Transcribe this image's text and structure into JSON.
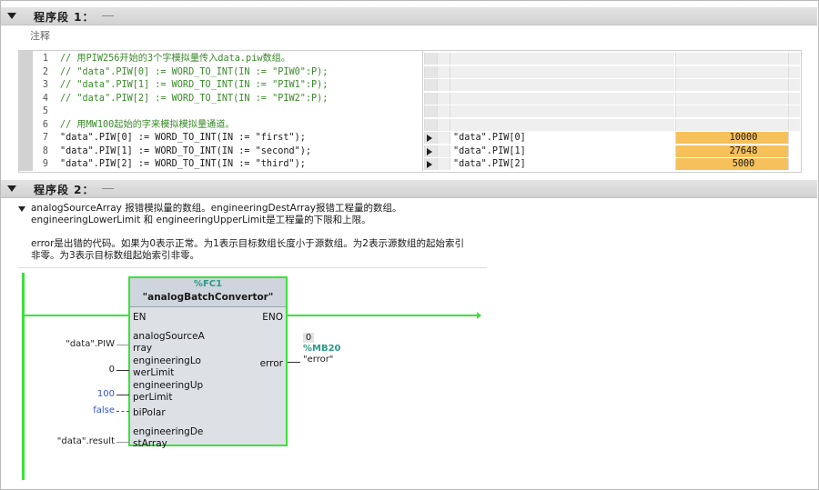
{
  "network1": {
    "title": "程序段 1：",
    "comment": "注释",
    "code": [
      {
        "num": "1",
        "text": "// 用PIW256开始的3个字模拟量传入data.piw数组。",
        "comment": true
      },
      {
        "num": "2",
        "text": "// \"data\".PIW[0] := WORD_TO_INT(IN := \"PIW0\":P);",
        "comment": true
      },
      {
        "num": "3",
        "text": "// \"data\".PIW[1] := WORD_TO_INT(IN := \"PIW1\":P);",
        "comment": true
      },
      {
        "num": "4",
        "text": "// \"data\".PIW[2] := WORD_TO_INT(IN := \"PIW2\":P);",
        "comment": true
      },
      {
        "num": "5",
        "text": "",
        "comment": false
      },
      {
        "num": "6",
        "text": "// 用MW100起始的字来模拟模拟量通道。",
        "comment": true
      },
      {
        "num": "7",
        "text": "\"data\".PIW[0] := WORD_TO_INT(IN := \"first\");",
        "comment": false
      },
      {
        "num": "8",
        "text": "\"data\".PIW[1] := WORD_TO_INT(IN := \"second\");",
        "comment": false
      },
      {
        "num": "9",
        "text": "\"data\".PIW[2] := WORD_TO_INT(IN := \"third\");",
        "comment": false
      }
    ],
    "monitor": [
      {
        "name": "\"data\".PIW[0]",
        "value": "10000"
      },
      {
        "name": "\"data\".PIW[1]",
        "value": "27648"
      },
      {
        "name": "\"data\".PIW[2]",
        "value": "5000"
      }
    ]
  },
  "network2": {
    "title": "程序段 2：",
    "description": [
      "analogSourceArray 报错模拟量的数组。engineeringDestArray报错工程量的数组。",
      "engineeringLowerLimit 和 engineeringUpperLimit是工程量的下限和上限。",
      "",
      "error是出错的代码。如果为0表示正常。为1表示目标数组长度小于源数组。为2表示源数组的起始索引",
      "非零。为3表示目标数组起始索引非零。"
    ],
    "block": {
      "address": "%FC1",
      "name": "\"analogBatchConvertor\"",
      "en": "EN",
      "eno": "ENO",
      "inputs": [
        {
          "pin1": "analogSourceA",
          "pin2": "rray",
          "actual": "\"data\".PIW"
        },
        {
          "pin1": "engineeringLo",
          "pin2": "werLimit",
          "actual": "0"
        },
        {
          "pin1": "engineeringUp",
          "pin2": "perLimit",
          "actual": "100"
        },
        {
          "pin1": "biPolar",
          "pin2": "",
          "actual": "false"
        },
        {
          "pin1": "engineeringDe",
          "pin2": "stArray",
          "actual": "\"data\".result"
        }
      ],
      "output": {
        "pin": "error",
        "monitor_value": "0",
        "address": "%MB20",
        "actual": "\"error\""
      }
    }
  },
  "colors": {
    "rung_green": "#3be13b",
    "monitor_orange": "#f6c05a",
    "address_teal": "#2a9a8a",
    "comment_green": "#3a8a2a"
  }
}
